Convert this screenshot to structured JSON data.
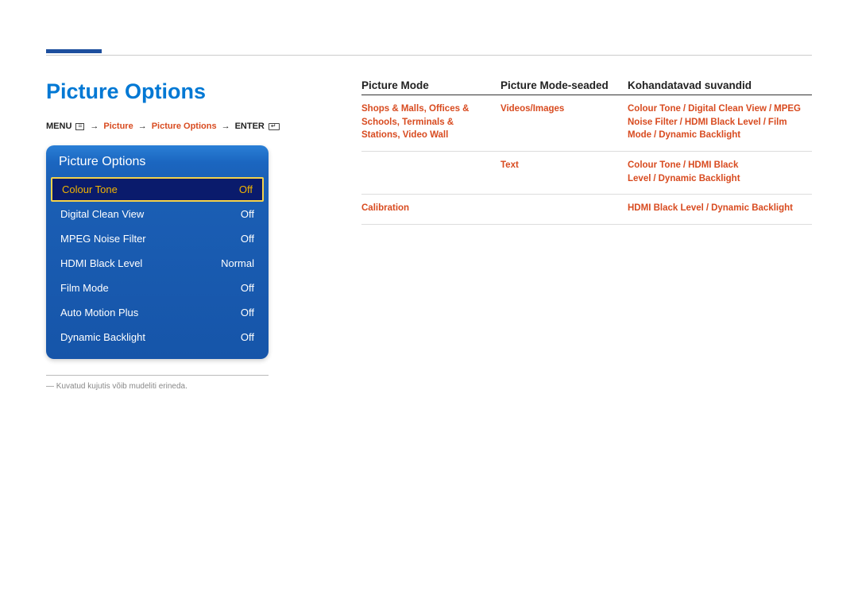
{
  "page": {
    "title": "Picture Options"
  },
  "breadcrumb": {
    "menu_label": "MENU",
    "arrow": "→",
    "step1": "Picture",
    "step2": "Picture Options",
    "enter_label": "ENTER"
  },
  "osd": {
    "header": "Picture Options",
    "rows": [
      {
        "label": "Colour Tone",
        "value": "Off",
        "selected": true
      },
      {
        "label": "Digital Clean View",
        "value": "Off",
        "selected": false
      },
      {
        "label": "MPEG Noise Filter",
        "value": "Off",
        "selected": false
      },
      {
        "label": "HDMI Black Level",
        "value": "Normal",
        "selected": false
      },
      {
        "label": "Film Mode",
        "value": "Off",
        "selected": false
      },
      {
        "label": "Auto Motion Plus",
        "value": "Off",
        "selected": false
      },
      {
        "label": "Dynamic Backlight",
        "value": "Off",
        "selected": false
      }
    ]
  },
  "footnote": {
    "dash": "―",
    "text": "Kuvatud kujutis võib mudeliti erineda."
  },
  "table": {
    "headers": {
      "col1": "Picture Mode",
      "col2": "Picture Mode-seaded",
      "col3": "Kohandatavad suvandid"
    },
    "rows": [
      {
        "col1_items": [
          "Shops & Malls",
          "Offices & Schools",
          "Terminals & Stations",
          "Video Wall"
        ],
        "col2": "Videos/Images",
        "col3_items": [
          "Colour Tone",
          "Digital Clean View",
          "MPEG Noise Filter",
          "HDMI Black Level",
          "Film Mode",
          "Dynamic Backlight"
        ]
      },
      {
        "col1_items": [],
        "col2": "Text",
        "col3_items": [
          "Colour Tone",
          "HDMI Black Level",
          "Dynamic Backlight"
        ]
      },
      {
        "col1_items": [
          "Calibration"
        ],
        "col2": "",
        "col3_items": [
          "HDMI Black Level",
          "Dynamic Backlight"
        ]
      }
    ]
  }
}
